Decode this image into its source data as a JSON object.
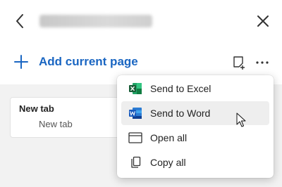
{
  "header": {
    "back_icon": "chevron-left-icon",
    "close_icon": "close-icon"
  },
  "toolbar": {
    "add_label": "Add current page",
    "add_icon": "plus-icon",
    "new_note_icon": "new-note-icon",
    "more_icon": "more-options-icon",
    "accent_color": "#1a66c2"
  },
  "collection": {
    "cards": [
      {
        "title": "New tab",
        "subtitle": "New tab"
      }
    ]
  },
  "menu": {
    "items": [
      {
        "label": "Send to Excel",
        "icon": "excel-icon"
      },
      {
        "label": "Send to Word",
        "icon": "word-icon",
        "hovered": true
      },
      {
        "label": "Open all",
        "icon": "window-icon"
      },
      {
        "label": "Copy all",
        "icon": "copy-icon"
      }
    ]
  }
}
